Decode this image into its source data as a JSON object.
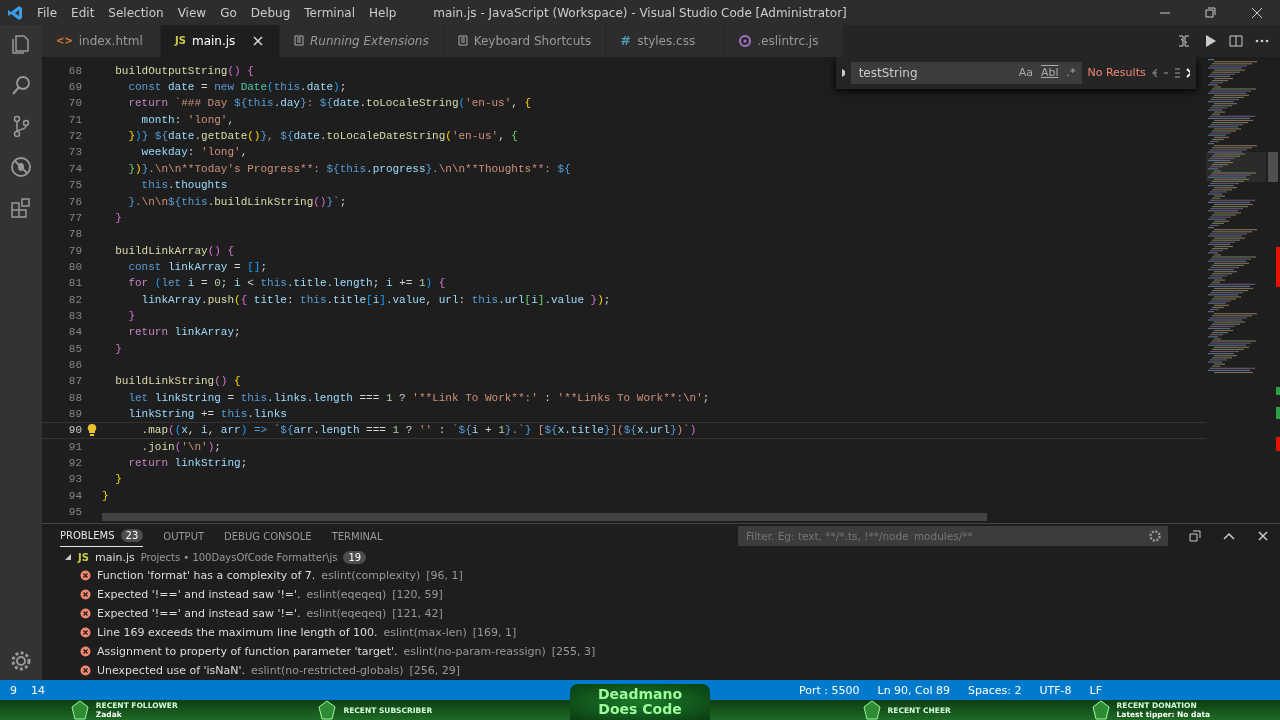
{
  "window": {
    "title": "main.js - JavaScript (Workspace) - Visual Studio Code [Administrator]"
  },
  "menu": [
    "File",
    "Edit",
    "Selection",
    "View",
    "Go",
    "Debug",
    "Terminal",
    "Help"
  ],
  "tabs": [
    {
      "label": "index.html",
      "kind": "html",
      "icon_text": "<>",
      "selected": false,
      "italic": false
    },
    {
      "label": "main.js",
      "kind": "js",
      "icon_text": "JS",
      "selected": true,
      "italic": false
    },
    {
      "label": "Running Extensions",
      "kind": "list",
      "selected": false,
      "italic": true
    },
    {
      "label": "Keyboard Shortcuts",
      "kind": "list",
      "selected": false,
      "italic": false
    },
    {
      "label": "styles.css",
      "kind": "css",
      "icon_text": "#",
      "selected": false,
      "italic": false
    },
    {
      "label": ".eslintrc.js",
      "kind": "eslint",
      "selected": false,
      "italic": false
    }
  ],
  "find": {
    "value": "testString",
    "case_label": "Aa",
    "word_label": "Abl",
    "regex_label": ".*",
    "result": "No Results"
  },
  "editor": {
    "lines": [
      {
        "number": "68",
        "current": false,
        "tokens": [
          {
            "text": "  buildOutputString",
            "kind": "fn"
          },
          {
            "text": "() {",
            "kind": "b2"
          }
        ]
      },
      {
        "number": "69",
        "current": false,
        "tokens": [
          {
            "text": "    const",
            "kind": "kw"
          },
          {
            "text": " date",
            "kind": "v"
          },
          {
            "text": " = ",
            "kind": "p"
          },
          {
            "text": "new",
            "kind": "kw"
          },
          {
            "text": " Date",
            "kind": "cls"
          },
          {
            "text": "(",
            "kind": "b3"
          },
          {
            "text": "this",
            "kind": "kw"
          },
          {
            "text": ".date",
            "kind": "v"
          },
          {
            "text": ")",
            "kind": "b3"
          },
          {
            "text": ";",
            "kind": "p"
          }
        ]
      },
      {
        "number": "70",
        "current": false,
        "tokens": [
          {
            "text": "    return",
            "kind": "ct"
          },
          {
            "text": " `### Day ",
            "kind": "s"
          },
          {
            "text": "${",
            "kind": "kw"
          },
          {
            "text": "this",
            "kind": "kw"
          },
          {
            "text": ".day",
            "kind": "v"
          },
          {
            "text": "}",
            "kind": "kw"
          },
          {
            "text": ": ",
            "kind": "s"
          },
          {
            "text": "${",
            "kind": "kw"
          },
          {
            "text": "date",
            "kind": "v"
          },
          {
            "text": ".toLocaleString",
            "kind": "fn"
          },
          {
            "text": "(",
            "kind": "b3"
          },
          {
            "text": "'en-us'",
            "kind": "s"
          },
          {
            "text": ", ",
            "kind": "p"
          },
          {
            "text": "{",
            "kind": "b1"
          }
        ]
      },
      {
        "number": "71",
        "current": false,
        "tokens": [
          {
            "text": "      month",
            "kind": "v"
          },
          {
            "text": ": ",
            "kind": "p"
          },
          {
            "text": "'long'",
            "kind": "s"
          },
          {
            "text": ",",
            "kind": "p"
          }
        ]
      },
      {
        "number": "72",
        "current": false,
        "tokens": [
          {
            "text": "    }",
            "kind": "b1"
          },
          {
            "text": ")",
            "kind": "b3"
          },
          {
            "text": "}",
            "kind": "kw"
          },
          {
            "text": " ${",
            "kind": "kw"
          },
          {
            "text": "date",
            "kind": "v"
          },
          {
            "text": ".getDate",
            "kind": "fn"
          },
          {
            "text": "()",
            "kind": "b1"
          },
          {
            "text": "}",
            "kind": "kw"
          },
          {
            "text": ", ",
            "kind": "s"
          },
          {
            "text": "${",
            "kind": "kw"
          },
          {
            "text": "date",
            "kind": "v"
          },
          {
            "text": ".toLocaleDateString",
            "kind": "fn"
          },
          {
            "text": "(",
            "kind": "b1"
          },
          {
            "text": "'en-us'",
            "kind": "s"
          },
          {
            "text": ", ",
            "kind": "p"
          },
          {
            "text": "{",
            "kind": "b4"
          }
        ]
      },
      {
        "number": "73",
        "current": false,
        "tokens": [
          {
            "text": "      weekday",
            "kind": "v"
          },
          {
            "text": ": ",
            "kind": "p"
          },
          {
            "text": "'long'",
            "kind": "s"
          },
          {
            "text": ",",
            "kind": "p"
          }
        ]
      },
      {
        "number": "74",
        "current": false,
        "tokens": [
          {
            "text": "    }",
            "kind": "b4"
          },
          {
            "text": ")",
            "kind": "b1"
          },
          {
            "text": "}",
            "kind": "kw"
          },
          {
            "text": ".\\n\\n**Today's Progress**: ",
            "kind": "s"
          },
          {
            "text": "${",
            "kind": "kw"
          },
          {
            "text": "this",
            "kind": "kw"
          },
          {
            "text": ".progress",
            "kind": "v"
          },
          {
            "text": "}",
            "kind": "kw"
          },
          {
            "text": ".\\n\\n**Thoughts**: ",
            "kind": "s"
          },
          {
            "text": "${",
            "kind": "kw"
          }
        ]
      },
      {
        "number": "75",
        "current": false,
        "tokens": [
          {
            "text": "      this",
            "kind": "kw"
          },
          {
            "text": ".thoughts",
            "kind": "v"
          }
        ]
      },
      {
        "number": "76",
        "current": false,
        "tokens": [
          {
            "text": "    }",
            "kind": "kw"
          },
          {
            "text": ".\\n\\n",
            "kind": "s"
          },
          {
            "text": "${",
            "kind": "kw"
          },
          {
            "text": "this",
            "kind": "kw"
          },
          {
            "text": ".buildLinkString",
            "kind": "fn"
          },
          {
            "text": "()",
            "kind": "b2"
          },
          {
            "text": "}",
            "kind": "kw"
          },
          {
            "text": "`",
            "kind": "s"
          },
          {
            "text": ";",
            "kind": "p"
          }
        ]
      },
      {
        "number": "77",
        "current": false,
        "tokens": [
          {
            "text": "  }",
            "kind": "b2"
          }
        ]
      },
      {
        "number": "78",
        "current": false
      },
      {
        "number": "79",
        "current": false,
        "tokens": [
          {
            "text": "  buildLinkArray",
            "kind": "fn"
          },
          {
            "text": "() {",
            "kind": "b2"
          }
        ]
      },
      {
        "number": "80",
        "current": false,
        "tokens": [
          {
            "text": "    const",
            "kind": "kw"
          },
          {
            "text": " linkArray",
            "kind": "v"
          },
          {
            "text": " = ",
            "kind": "p"
          },
          {
            "text": "[]",
            "kind": "b3"
          },
          {
            "text": ";",
            "kind": "p"
          }
        ]
      },
      {
        "number": "81",
        "current": false,
        "tokens": [
          {
            "text": "    for",
            "kind": "ct"
          },
          {
            "text": " (",
            "kind": "b3"
          },
          {
            "text": "let",
            "kind": "kw"
          },
          {
            "text": " i",
            "kind": "v"
          },
          {
            "text": " = ",
            "kind": "p"
          },
          {
            "text": "0",
            "kind": "n"
          },
          {
            "text": "; ",
            "kind": "p"
          },
          {
            "text": "i",
            "kind": "v"
          },
          {
            "text": " < ",
            "kind": "p"
          },
          {
            "text": "this",
            "kind": "kw"
          },
          {
            "text": ".title.length",
            "kind": "v"
          },
          {
            "text": "; ",
            "kind": "p"
          },
          {
            "text": "i",
            "kind": "v"
          },
          {
            "text": " += ",
            "kind": "p"
          },
          {
            "text": "1",
            "kind": "n"
          },
          {
            "text": ")",
            "kind": "b3"
          },
          {
            "text": " {",
            "kind": "b2"
          }
        ]
      },
      {
        "number": "82",
        "current": false,
        "tokens": [
          {
            "text": "      linkArray",
            "kind": "v"
          },
          {
            "text": ".push",
            "kind": "fn"
          },
          {
            "text": "(",
            "kind": "b1"
          },
          {
            "text": "{",
            "kind": "b2"
          },
          {
            "text": " title",
            "kind": "v"
          },
          {
            "text": ": ",
            "kind": "p"
          },
          {
            "text": "this",
            "kind": "kw"
          },
          {
            "text": ".title",
            "kind": "v"
          },
          {
            "text": "[",
            "kind": "b3"
          },
          {
            "text": "i",
            "kind": "v"
          },
          {
            "text": "]",
            "kind": "b3"
          },
          {
            "text": ".value",
            "kind": "v"
          },
          {
            "text": ", ",
            "kind": "p"
          },
          {
            "text": "url",
            "kind": "v"
          },
          {
            "text": ": ",
            "kind": "p"
          },
          {
            "text": "this",
            "kind": "kw"
          },
          {
            "text": ".url",
            "kind": "v"
          },
          {
            "text": "[",
            "kind": "b4"
          },
          {
            "text": "i",
            "kind": "v"
          },
          {
            "text": "]",
            "kind": "b4"
          },
          {
            "text": ".value",
            "kind": "v"
          },
          {
            "text": " }",
            "kind": "b2"
          },
          {
            "text": ")",
            "kind": "b1"
          },
          {
            "text": ";",
            "kind": "p"
          }
        ]
      },
      {
        "number": "83",
        "current": false,
        "tokens": [
          {
            "text": "    }",
            "kind": "b2"
          }
        ]
      },
      {
        "number": "84",
        "current": false,
        "tokens": [
          {
            "text": "    return",
            "kind": "ct"
          },
          {
            "text": " linkArray",
            "kind": "v"
          },
          {
            "text": ";",
            "kind": "p"
          }
        ]
      },
      {
        "number": "85",
        "current": false,
        "tokens": [
          {
            "text": "  }",
            "kind": "b2"
          }
        ]
      },
      {
        "number": "86",
        "current": false
      },
      {
        "number": "87",
        "current": false,
        "tokens": [
          {
            "text": "  buildLinkString",
            "kind": "fn"
          },
          {
            "text": "()",
            "kind": "b2"
          },
          {
            "text": " {",
            "kind": "b1"
          }
        ]
      },
      {
        "number": "88",
        "current": false,
        "tokens": [
          {
            "text": "    let",
            "kind": "kw"
          },
          {
            "text": " linkString",
            "kind": "v"
          },
          {
            "text": " = ",
            "kind": "p"
          },
          {
            "text": "this",
            "kind": "kw"
          },
          {
            "text": ".links.length",
            "kind": "v"
          },
          {
            "text": " === ",
            "kind": "p"
          },
          {
            "text": "1",
            "kind": "n"
          },
          {
            "text": " ? ",
            "kind": "p"
          },
          {
            "text": "'**Link To Work**:'",
            "kind": "s"
          },
          {
            "text": " : ",
            "kind": "p"
          },
          {
            "text": "'**Links To Work**:\\n'",
            "kind": "s"
          },
          {
            "text": ";",
            "kind": "p"
          }
        ]
      },
      {
        "number": "89",
        "current": false,
        "tokens": [
          {
            "text": "    linkString",
            "kind": "v"
          },
          {
            "text": " += ",
            "kind": "p"
          },
          {
            "text": "this",
            "kind": "kw"
          },
          {
            "text": ".links",
            "kind": "v"
          }
        ]
      },
      {
        "number": "90",
        "current": true,
        "tokens": [
          {
            "text": "      .map",
            "kind": "fn"
          },
          {
            "text": "(",
            "kind": "b2"
          },
          {
            "text": "(",
            "kind": "b3"
          },
          {
            "text": "x",
            "kind": "v"
          },
          {
            "text": ", ",
            "kind": "p"
          },
          {
            "text": "i",
            "kind": "v"
          },
          {
            "text": ", ",
            "kind": "p"
          },
          {
            "text": "arr",
            "kind": "v"
          },
          {
            "text": ")",
            "kind": "b3"
          },
          {
            "text": " => ",
            "kind": "kw"
          },
          {
            "text": "`",
            "kind": "s"
          },
          {
            "text": "${",
            "kind": "kw"
          },
          {
            "text": "arr.length",
            "kind": "v"
          },
          {
            "text": " === ",
            "kind": "p"
          },
          {
            "text": "1",
            "kind": "n"
          },
          {
            "text": " ? ",
            "kind": "p"
          },
          {
            "text": "''",
            "kind": "s"
          },
          {
            "text": " : ",
            "kind": "p"
          },
          {
            "text": "`",
            "kind": "s"
          },
          {
            "text": "${",
            "kind": "kw"
          },
          {
            "text": "i",
            "kind": "v"
          },
          {
            "text": " + ",
            "kind": "p"
          },
          {
            "text": "1",
            "kind": "n"
          },
          {
            "text": "}",
            "kind": "kw"
          },
          {
            "text": ".`",
            "kind": "s"
          },
          {
            "text": "}",
            "kind": "kw"
          },
          {
            "text": " [",
            "kind": "s"
          },
          {
            "text": "${",
            "kind": "kw"
          },
          {
            "text": "x.title",
            "kind": "v"
          },
          {
            "text": "}",
            "kind": "kw"
          },
          {
            "text": "](",
            "kind": "s"
          },
          {
            "text": "${",
            "kind": "kw"
          },
          {
            "text": "x.url",
            "kind": "v"
          },
          {
            "text": "}",
            "kind": "kw"
          },
          {
            "text": ")`",
            "kind": "s"
          },
          {
            "text": ")",
            "kind": "b2"
          }
        ]
      },
      {
        "number": "91",
        "current": false,
        "tokens": [
          {
            "text": "      .join",
            "kind": "fn"
          },
          {
            "text": "(",
            "kind": "b2"
          },
          {
            "text": "'\\n'",
            "kind": "s"
          },
          {
            "text": ")",
            "kind": "b2"
          },
          {
            "text": ";",
            "kind": "p"
          }
        ]
      },
      {
        "number": "92",
        "current": false,
        "tokens": [
          {
            "text": "    return",
            "kind": "ct"
          },
          {
            "text": " linkString",
            "kind": "v"
          },
          {
            "text": ";",
            "kind": "p"
          }
        ]
      },
      {
        "number": "93",
        "current": false,
        "tokens": [
          {
            "text": "  }",
            "kind": "b1"
          }
        ]
      },
      {
        "number": "94",
        "current": false,
        "tokens": [
          {
            "text": "}",
            "kind": "b1"
          }
        ]
      },
      {
        "number": "95",
        "current": false
      }
    ]
  },
  "panel": {
    "tabs": [
      {
        "label": "PROBLEMS",
        "count": "23",
        "selected": true
      },
      {
        "label": "OUTPUT",
        "selected": false
      },
      {
        "label": "DEBUG CONSOLE",
        "selected": false
      },
      {
        "label": "TERMINAL",
        "selected": false
      }
    ],
    "filter_placeholder": "Filter. Eg: text, **/*.ts, !**/node_modules/**",
    "file": {
      "icon_text": "JS",
      "name": "main.js",
      "path": "Projects • 100DaysOfCode Formatter\\js",
      "count": "19",
      "expanded": true
    },
    "problems": [
      {
        "message": "Function 'format' has a complexity of 7.",
        "source": "eslint(complexity)",
        "position": "[96, 1]"
      },
      {
        "message": "Expected '!==' and instead saw '!='.",
        "source": "eslint(eqeqeq)",
        "position": "[120, 59]"
      },
      {
        "message": "Expected '!==' and instead saw '!='.",
        "source": "eslint(eqeqeq)",
        "position": "[121, 42]"
      },
      {
        "message": "Line 169 exceeds the maximum line length of 100.",
        "source": "eslint(max-len)",
        "position": "[169, 1]"
      },
      {
        "message": "Assignment to property of function parameter 'target'.",
        "source": "eslint(no-param-reassign)",
        "position": "[255, 3]"
      },
      {
        "message": "Unexpected use of 'isNaN'.",
        "source": "eslint(no-restricted-globals)",
        "position": "[256, 29]"
      }
    ]
  },
  "status_bar": {
    "errors": "9",
    "warnings": "14",
    "items": [
      "Port : 5500",
      "Ln 90, Col 89",
      "Spaces: 2",
      "UTF-8",
      "LF"
    ]
  },
  "overlay": {
    "logo_lines": [
      "Deadmano",
      "Does Code"
    ],
    "panels": [
      {
        "title": "RECENT FOLLOWER",
        "detail": "Zadak"
      },
      {
        "title": "RECENT SUBSCRIBER"
      },
      {
        "title": "RECENT CHEER"
      },
      {
        "title": "RECENT DONATION",
        "detail": "Latest tipper: No data"
      }
    ]
  }
}
